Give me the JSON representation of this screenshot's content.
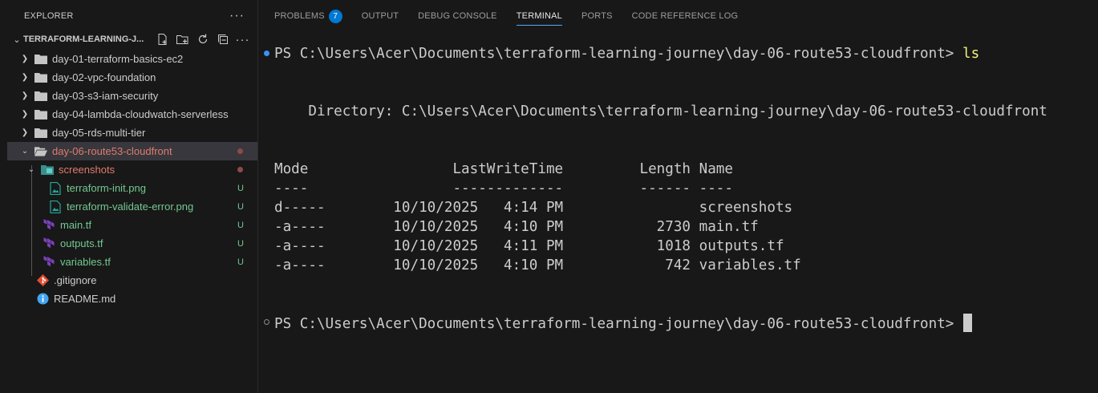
{
  "explorer": {
    "header": "EXPLORER",
    "more": "···",
    "root_folder": "TERRAFORM-LEARNING-J...",
    "items": [
      {
        "label": "day-01-terraform-basics-ec2",
        "type": "folder",
        "state": "collapsed",
        "color": "#cccccc"
      },
      {
        "label": "day-02-vpc-foundation",
        "type": "folder",
        "state": "collapsed",
        "color": "#cccccc"
      },
      {
        "label": "day-03-s3-iam-security",
        "type": "folder",
        "state": "collapsed",
        "color": "#cccccc"
      },
      {
        "label": "day-04-lambda-cloudwatch-serverless",
        "type": "folder",
        "state": "collapsed",
        "color": "#cccccc"
      },
      {
        "label": "day-05-rds-multi-tier",
        "type": "folder",
        "state": "collapsed",
        "color": "#cccccc"
      },
      {
        "label": "day-06-route53-cloudfront",
        "type": "folder",
        "state": "expanded",
        "color": "#e07c6c"
      },
      {
        "label": "screenshots",
        "type": "folder",
        "state": "expanded",
        "color": "#e07c6c"
      },
      {
        "label": "terraform-init.png",
        "type": "image",
        "color": "#73c991",
        "badge": "U"
      },
      {
        "label": "terraform-validate-error.png",
        "type": "image",
        "color": "#73c991",
        "badge": "U"
      },
      {
        "label": "main.tf",
        "type": "terraform",
        "color": "#73c991",
        "badge": "U"
      },
      {
        "label": "outputs.tf",
        "type": "terraform",
        "color": "#73c991",
        "badge": "U"
      },
      {
        "label": "variables.tf",
        "type": "terraform",
        "color": "#73c991",
        "badge": "U"
      },
      {
        "label": ".gitignore",
        "type": "git",
        "color": "#cccccc"
      },
      {
        "label": "README.md",
        "type": "info",
        "color": "#cccccc"
      }
    ]
  },
  "panel": {
    "tabs": [
      {
        "label": "PROBLEMS",
        "count": "7"
      },
      {
        "label": "OUTPUT"
      },
      {
        "label": "DEBUG CONSOLE"
      },
      {
        "label": "TERMINAL",
        "active": true
      },
      {
        "label": "PORTS"
      },
      {
        "label": "CODE REFERENCE LOG"
      }
    ]
  },
  "terminal": {
    "prompt1": "PS C:\\Users\\Acer\\Documents\\terraform-learning-journey\\day-06-route53-cloudfront> ",
    "command1": "ls",
    "directory_line": "    Directory: C:\\Users\\Acer\\Documents\\terraform-learning-journey\\day-06-route53-cloudfront",
    "header": "Mode                 LastWriteTime         Length Name",
    "divider": "----                 -------------         ------ ----",
    "rows": [
      "d-----        10/10/2025   4:14 PM                screenshots",
      "-a----        10/10/2025   4:10 PM           2730 main.tf",
      "-a----        10/10/2025   4:11 PM           1018 outputs.tf",
      "-a----        10/10/2025   4:10 PM            742 variables.tf"
    ],
    "prompt2": "PS C:\\Users\\Acer\\Documents\\terraform-learning-journey\\day-06-route53-cloudfront> "
  }
}
